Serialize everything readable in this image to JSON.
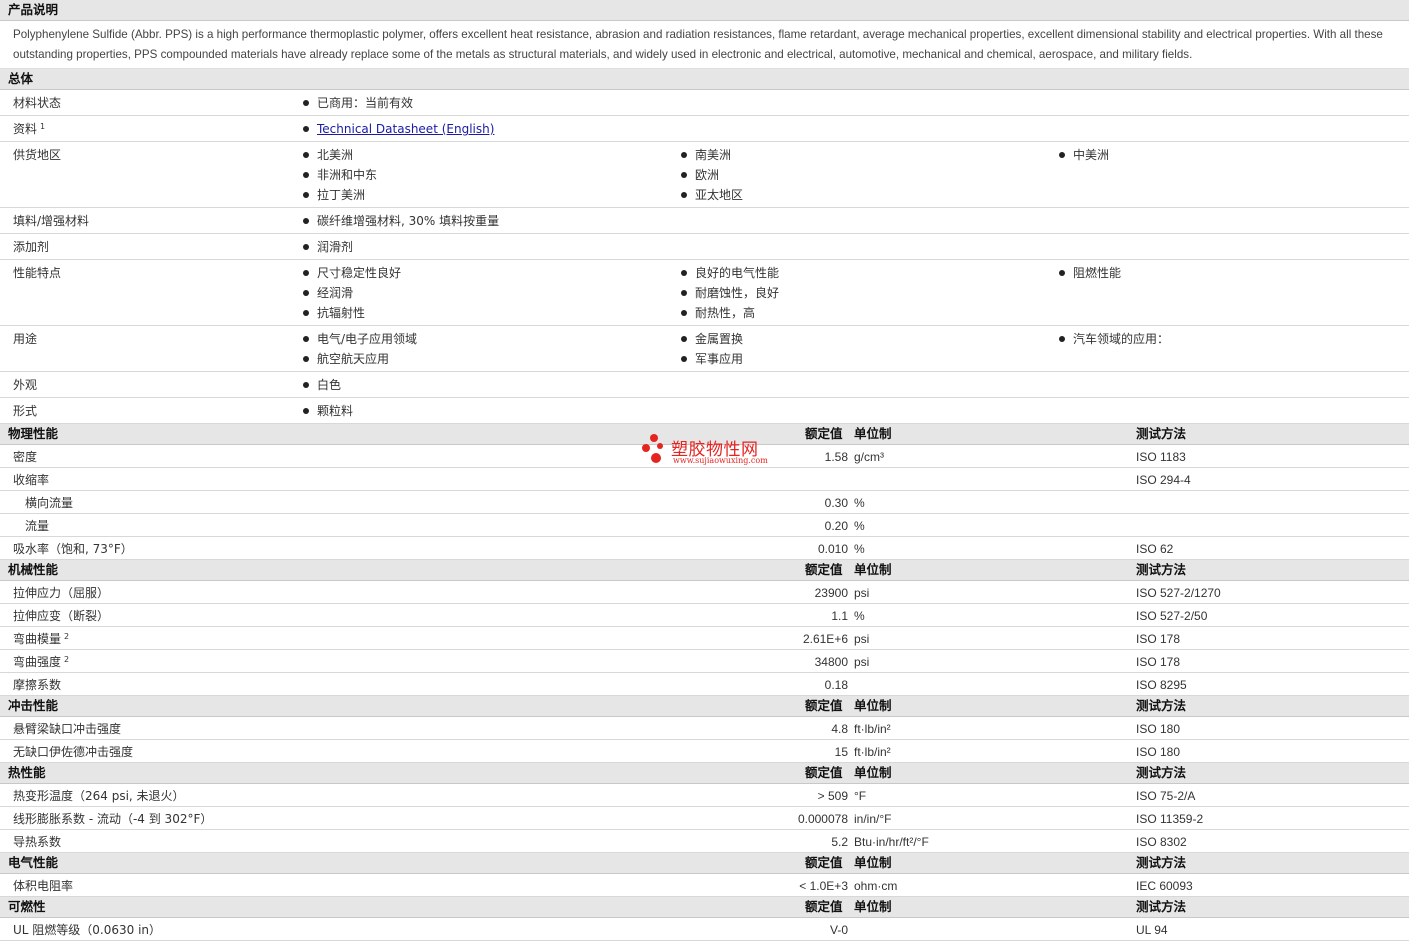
{
  "description": {
    "title": "产品说明",
    "text": "Polyphenylene Sulfide (Abbr. PPS) is a high performance thermoplastic polymer, offers excellent heat resistance, abrasion and radiation resistances, flame retardant, average mechanical properties, excellent dimensional stability and electrical properties. With all these outstanding properties, PPS compounded materials have already replace some of the metals as structural materials, and widely used in electronic and electrical, automotive, mechanical and chemical, aerospace, and military fields."
  },
  "general": {
    "title": "总体",
    "rows": [
      {
        "label": "材料状态",
        "values": [
          "已商用：当前有效"
        ],
        "single": true
      },
      {
        "label": "资料",
        "sup": "1",
        "values": [
          "Technical Datasheet (English)"
        ],
        "link": true,
        "single": true
      },
      {
        "label": "供货地区",
        "values": [
          "北美洲",
          "南美洲",
          "中美洲",
          "非洲和中东",
          "欧洲",
          "",
          "拉丁美洲",
          "亚太地区",
          ""
        ]
      },
      {
        "label": "填料/增强材料",
        "values": [
          "碳纤维增强材料, 30% 填料按重量"
        ],
        "single": true
      },
      {
        "label": "添加剂",
        "values": [
          "润滑剂"
        ],
        "single": true
      },
      {
        "label": "性能特点",
        "values": [
          "尺寸稳定性良好",
          "良好的电气性能",
          "阻燃性能",
          "经润滑",
          "耐磨蚀性，良好",
          "",
          "抗辐射性",
          "耐热性，高",
          ""
        ]
      },
      {
        "label": "用途",
        "values": [
          "电气/电子应用领域",
          "金属置换",
          "汽车领域的应用：",
          "航空航天应用",
          "军事应用",
          ""
        ]
      },
      {
        "label": "外观",
        "values": [
          "白色"
        ],
        "single": true
      },
      {
        "label": "形式",
        "values": [
          "颗粒料"
        ],
        "single": true
      }
    ]
  },
  "col_headers": {
    "value": "额定值",
    "unit": "单位制",
    "method": "测试方法"
  },
  "property_sections": [
    {
      "title": "物理性能",
      "rows": [
        {
          "label": "密度",
          "value": "1.58",
          "unit": "g/cm³",
          "method": "ISO 1183"
        },
        {
          "label": "收缩率",
          "value": "",
          "unit": "",
          "method": "ISO 294-4"
        },
        {
          "label": "横向流量",
          "value": "0.30",
          "unit": "%",
          "method": "",
          "sub": true
        },
        {
          "label": "流量",
          "value": "0.20",
          "unit": "%",
          "method": "",
          "sub": true
        },
        {
          "label": "吸水率（饱和, 73°F）",
          "value": "0.010",
          "unit": "%",
          "method": "ISO 62"
        }
      ]
    },
    {
      "title": "机械性能",
      "rows": [
        {
          "label": "拉伸应力（屈服）",
          "value": "23900",
          "unit": "psi",
          "method": "ISO 527-2/1270"
        },
        {
          "label": "拉伸应变（断裂）",
          "value": "1.1",
          "unit": "%",
          "method": "ISO 527-2/50"
        },
        {
          "label": "弯曲模量",
          "sup": "2",
          "value": "2.61E+6",
          "unit": "psi",
          "method": "ISO 178"
        },
        {
          "label": "弯曲强度",
          "sup": "2",
          "value": "34800",
          "unit": "psi",
          "method": "ISO 178"
        },
        {
          "label": "摩擦系数",
          "value": "0.18",
          "unit": "",
          "method": "ISO 8295"
        }
      ]
    },
    {
      "title": "冲击性能",
      "rows": [
        {
          "label": "悬臂梁缺口冲击强度",
          "value": "4.8",
          "unit": "ft·lb/in²",
          "method": "ISO 180"
        },
        {
          "label": "无缺口伊佐德冲击强度",
          "value": "15",
          "unit": "ft·lb/in²",
          "method": "ISO 180"
        }
      ]
    },
    {
      "title": "热性能",
      "rows": [
        {
          "label": "热变形温度（264 psi, 未退火）",
          "value": "> 509",
          "unit": "°F",
          "method": "ISO 75-2/A"
        },
        {
          "label": "线形膨胀系数 - 流动（-4 到 302°F）",
          "value": "0.000078",
          "unit": "in/in/°F",
          "method": "ISO 11359-2"
        },
        {
          "label": "导热系数",
          "value": "5.2",
          "unit": "Btu·in/hr/ft²/°F",
          "method": "ISO 8302"
        }
      ]
    },
    {
      "title": "电气性能",
      "rows": [
        {
          "label": "体积电阻率",
          "value": "< 1.0E+3",
          "unit": "ohm·cm",
          "method": "IEC 60093"
        }
      ]
    },
    {
      "title": "可燃性",
      "rows": [
        {
          "label": "UL 阻燃等级（0.0630 in）",
          "value": "V-0",
          "unit": "",
          "method": "UL 94"
        }
      ]
    }
  ],
  "watermark": {
    "name": "塑胶物性网",
    "url": "www.sujiaowuxing.com",
    "color": "#e52420"
  }
}
